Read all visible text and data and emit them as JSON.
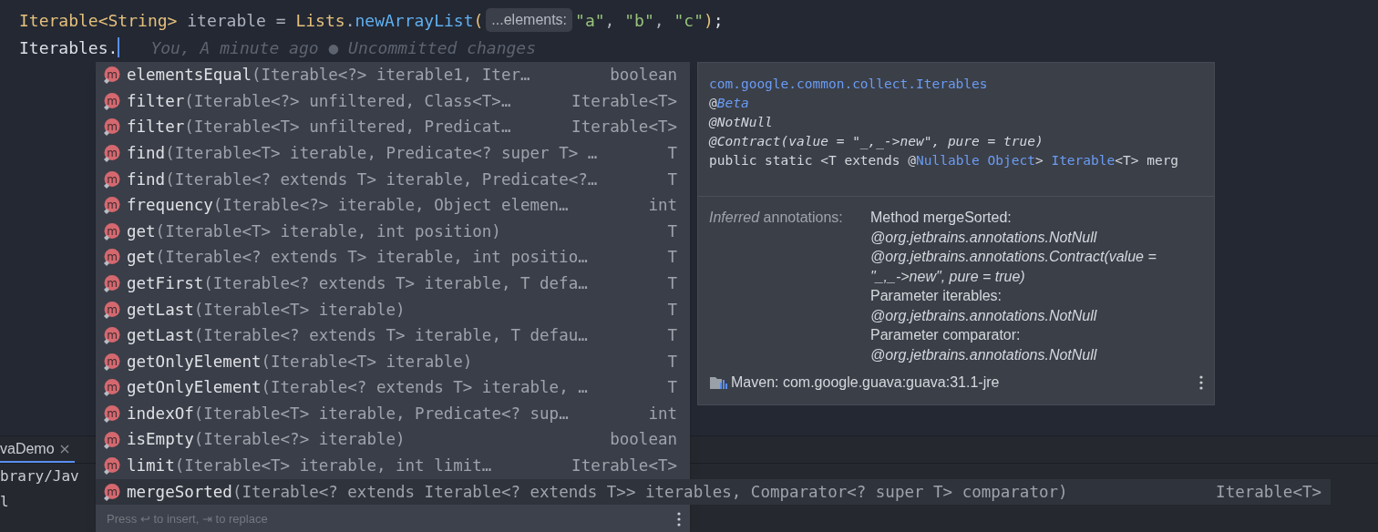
{
  "editor": {
    "lines": [
      {
        "tokens": [
          {
            "text": "Iterable<String>",
            "kind": "type"
          },
          {
            "text": " iterable = ",
            "kind": "plain"
          },
          {
            "text": "Lists",
            "kind": "type"
          },
          {
            "text": ".",
            "kind": "plain"
          },
          {
            "text": "newArrayList",
            "kind": "method"
          },
          {
            "text": "(",
            "kind": "type"
          },
          {
            "text": "...elements:",
            "kind": "hint"
          },
          {
            "text": "\"a\"",
            "kind": "string"
          },
          {
            "text": ", ",
            "kind": "plain"
          },
          {
            "text": "\"b\"",
            "kind": "string"
          },
          {
            "text": ", ",
            "kind": "plain"
          },
          {
            "text": "\"c\"",
            "kind": "string"
          },
          {
            "text": ")",
            "kind": "type"
          },
          {
            "text": ";",
            "kind": "punct"
          }
        ],
        "caret": false
      },
      {
        "tokens": [
          {
            "text": "Iterables.",
            "kind": "punct"
          }
        ],
        "caret": true,
        "blame": "You, A minute ago ● Uncommitted changes"
      }
    ]
  },
  "completion": {
    "items": [
      {
        "icon": "m",
        "name": "elementsEqual",
        "params": "(Iterable<?> iterable1, Iter…",
        "type": "boolean",
        "selected": false
      },
      {
        "icon": "m",
        "name": "filter",
        "params": "(Iterable<?> unfiltered, Class<T>…",
        "type": "Iterable<T>",
        "selected": false
      },
      {
        "icon": "m",
        "name": "filter",
        "params": "(Iterable<T> unfiltered, Predicat…",
        "type": "Iterable<T>",
        "selected": false
      },
      {
        "icon": "m",
        "name": "find",
        "params": "(Iterable<T> iterable, Predicate<? super T> …",
        "type": "T",
        "selected": false
      },
      {
        "icon": "m",
        "name": "find",
        "params": "(Iterable<? extends T> iterable, Predicate<?…",
        "type": "T",
        "selected": false
      },
      {
        "icon": "m",
        "name": "frequency",
        "params": "(Iterable<?> iterable, Object elemen…",
        "type": "int",
        "selected": false
      },
      {
        "icon": "m",
        "name": "get",
        "params": "(Iterable<T> iterable, int position)",
        "type": "T",
        "selected": false
      },
      {
        "icon": "m",
        "name": "get",
        "params": "(Iterable<? extends T> iterable, int positio…",
        "type": "T",
        "selected": false
      },
      {
        "icon": "m",
        "name": "getFirst",
        "params": "(Iterable<? extends T> iterable, T defa…",
        "type": "T",
        "selected": false
      },
      {
        "icon": "m",
        "name": "getLast",
        "params": "(Iterable<T> iterable)",
        "type": "T",
        "selected": false
      },
      {
        "icon": "m",
        "name": "getLast",
        "params": "(Iterable<? extends T> iterable, T defau…",
        "type": "T",
        "selected": false
      },
      {
        "icon": "m",
        "name": "getOnlyElement",
        "params": "(Iterable<T> iterable)",
        "type": "T",
        "selected": false
      },
      {
        "icon": "m",
        "name": "getOnlyElement",
        "params": "(Iterable<? extends T> iterable, …",
        "type": "T",
        "selected": false
      },
      {
        "icon": "m",
        "name": "indexOf",
        "params": "(Iterable<T> iterable, Predicate<? sup…",
        "type": "int",
        "selected": false
      },
      {
        "icon": "m",
        "name": "isEmpty",
        "params": "(Iterable<?> iterable)",
        "type": "boolean",
        "selected": false
      },
      {
        "icon": "m",
        "name": "limit",
        "params": "(Iterable<T> iterable, int limit…",
        "type": "Iterable<T>",
        "selected": false
      },
      {
        "icon": "m",
        "name": "mergeSorted",
        "params": "(Iterable<? extends Iterable<? extends T>> iterables, Comparator<? super T> comparator)",
        "type": "Iterable<T>",
        "selected": true
      }
    ],
    "footer": "Press ↩ to insert, ⇥ to replace"
  },
  "documentation": {
    "signature": [
      [
        {
          "text": "com.google.common.collect.Iterables",
          "kind": "link"
        }
      ],
      [
        {
          "text": "@",
          "kind": "plain"
        },
        {
          "text": "Beta",
          "kind": "link-italic"
        }
      ],
      [
        {
          "text": "@NotNull",
          "kind": "italic"
        }
      ],
      [
        {
          "text": "@Contract(value = \"_,_->new\", pure = true)",
          "kind": "italic"
        }
      ],
      [
        {
          "text": "public static <T extends @",
          "kind": "plain"
        },
        {
          "text": "Nullable Object",
          "kind": "link"
        },
        {
          "text": "> ",
          "kind": "plain"
        },
        {
          "text": "Iterable",
          "kind": "link"
        },
        {
          "text": "<T> merg",
          "kind": "plain"
        }
      ]
    ],
    "inferred_label": "*Inferred* annotations:",
    "inferred_lines": [
      {
        "text": "Method mergeSorted:",
        "italic": false
      },
      {
        "text": "@org.jetbrains.annotations.NotNull",
        "italic": true
      },
      {
        "text": "@org.jetbrains.annotations.Contract(value = \"_,_->new\", pure = true)",
        "italic": true
      },
      {
        "text": "Parameter iterables:",
        "italic": false
      },
      {
        "text": "@org.jetbrains.annotations.NotNull",
        "italic": true
      },
      {
        "text": "Parameter comparator:",
        "italic": false
      },
      {
        "text": "@org.jetbrains.annotations.NotNull",
        "italic": true
      }
    ],
    "library": "Maven: com.google.guava:guava:31.1-jre"
  },
  "bottom_panel": {
    "tab": "vaDemo",
    "lines": [
      "brary/Jav",
      "l"
    ]
  }
}
